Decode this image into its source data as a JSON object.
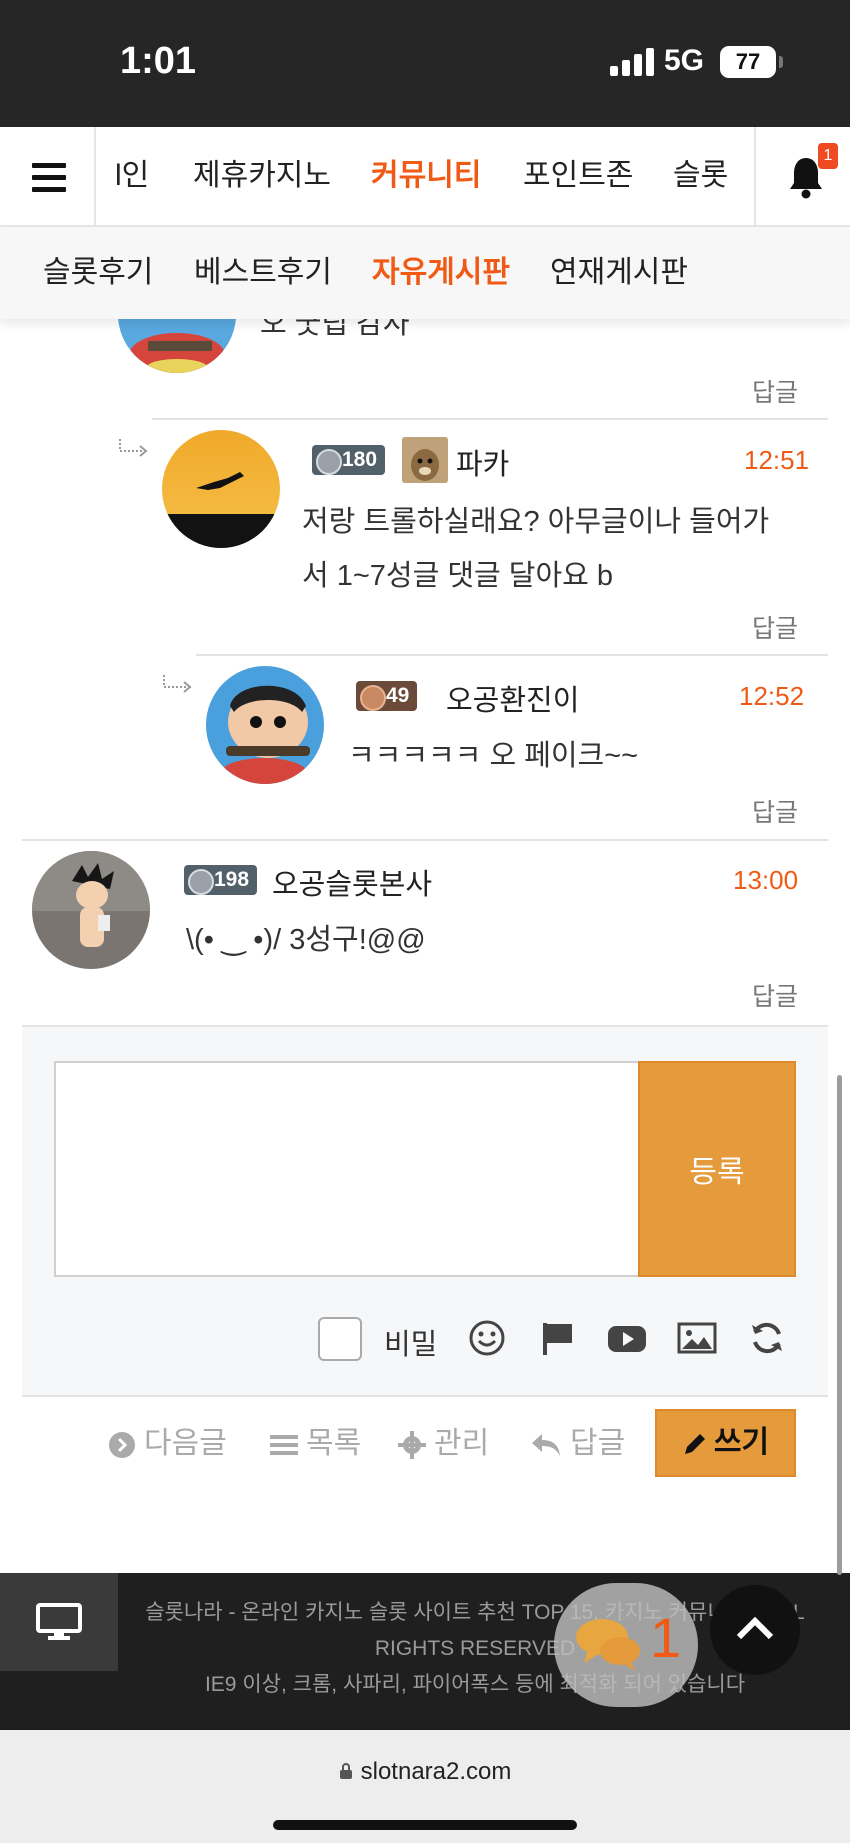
{
  "status_bar": {
    "time": "1:01",
    "network": "5G",
    "battery": "77"
  },
  "nav": {
    "items": [
      "l인",
      "제휴카지노",
      "커뮤니티",
      "포인트존",
      "슬롯"
    ],
    "active": "커뮤니티",
    "notification_count": "1"
  },
  "sub_nav": {
    "items": [
      "슬롯후기",
      "베스트후기",
      "자유게시판",
      "연재게시판"
    ],
    "active": "자유게시판"
  },
  "comments": [
    {
      "text": "오 굿팁 감사",
      "reply_label": "답글"
    },
    {
      "level": "180",
      "name": "파카",
      "time": "12:51",
      "text": "저랑 트롤하실래요? 아무글이나 들어가\n서 1~7성글 댓글 달아요 b",
      "reply_label": "답글"
    },
    {
      "level": "49",
      "name": "오공환진이",
      "time": "12:52",
      "text": "ㅋㅋㅋㅋㅋ 오 페이크~~",
      "reply_label": "답글"
    },
    {
      "level": "198",
      "name": "오공슬롯본사",
      "time": "13:00",
      "text": "\\(• ‿ •)/ 3성구!@@",
      "reply_label": "답글"
    }
  ],
  "comment_form": {
    "input_value": "",
    "submit_label": "등록",
    "secret_label": "비밀",
    "tools": [
      "smile-icon",
      "flag-icon",
      "youtube-icon",
      "image-icon",
      "refresh-icon"
    ]
  },
  "actions": {
    "next": "다음글",
    "list": "목록",
    "manage": "관리",
    "reply": "답글",
    "write": "쓰기"
  },
  "footer": {
    "line1": "슬롯나라 - 온라인 카지노 슬롯 사이트 추천 TOP 15, 카지노 커뮤니티 ©ALL",
    "line2": "RIGHTS RESERVED",
    "line3": "IE9 이상, 크롬, 사파리, 파이어폭스 등에 최적화 되어 있습니다"
  },
  "chat_count": "1",
  "url": "slotnara2.com",
  "colors": {
    "accent": "#f05a14",
    "button": "#e59a3c",
    "footer_bg": "#1f1f1f",
    "status_bg": "#262626"
  }
}
